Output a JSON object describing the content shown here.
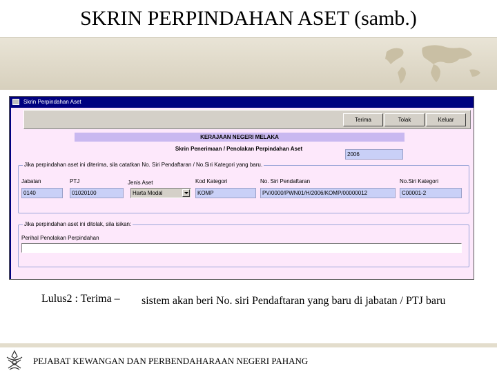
{
  "slide": {
    "title": "SKRIN PERPINDAHAN ASET (samb.)",
    "note_label": "Lulus2 : Terima  –",
    "note_text": "sistem akan beri No. siri Pendaftaran yang baru di jabatan / PTJ baru",
    "footer": "PEJABAT KEWANGAN DAN PERBENDAHARAAN NEGERI PAHANG"
  },
  "window": {
    "title": "Skrin Perpindahan Aset"
  },
  "toolbar": {
    "terima": "Terima",
    "tolak": "Tolak",
    "keluar": "Keluar"
  },
  "form": {
    "header": "KERAJAAN NEGERI MELAKA",
    "subheader": "Skrin Penerimaan / Penolakan Perpindahan Aset",
    "year": "2006",
    "group1_legend": "Jika perpindahan aset ini diterima, sila catatkan No. Siri Pendaftaran / No.Siri Kategori yang baru.",
    "fields": {
      "jabatan": {
        "label": "Jabatan",
        "value": "0140"
      },
      "ptj": {
        "label": "PTJ",
        "value": "01020100"
      },
      "jenis_aset": {
        "label": "Jenis Aset",
        "value": "Harta Modal"
      },
      "kod_kategori": {
        "label": "Kod Kategori",
        "value": "KOMP"
      },
      "no_siri_pendaftaran": {
        "label": "No. Siri Pendaftaran",
        "value": "PV/0000/PWN01/H/2006/KOMP/00000012"
      },
      "no_siri_kategori": {
        "label": "No.Siri Kategori",
        "value": "C00001-2"
      }
    },
    "group2_legend": "Jika perpindahan aset ini ditolak, sila isikan:",
    "penolakan_label": "Perihal Penolakan Perpindahan",
    "penolakan_value": ""
  }
}
